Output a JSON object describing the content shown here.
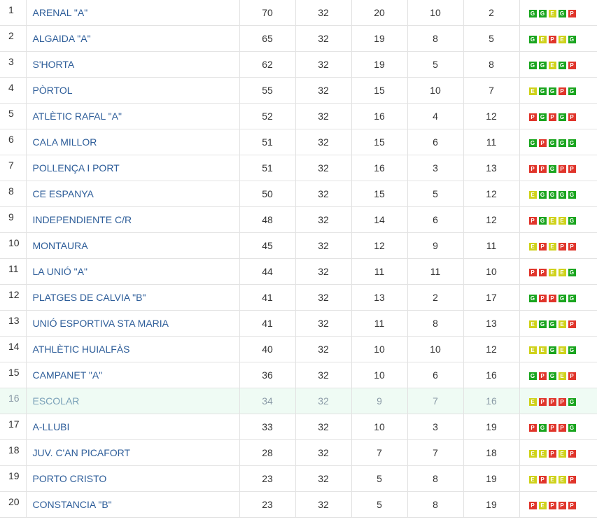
{
  "colors": {
    "win": "#1aa51f",
    "draw": "#cfd21b",
    "loss": "#e0352b",
    "highlight_row": "#effbf4",
    "team_link": "#2d5d99"
  },
  "rows": [
    {
      "pos": "1",
      "team": "ARENAL \"A\"",
      "pts": "70",
      "pj": "32",
      "pg": "20",
      "pe": "10",
      "pp": "2",
      "form": [
        "G",
        "G",
        "E",
        "G",
        "P"
      ]
    },
    {
      "pos": "2",
      "team": "ALGAIDA \"A\"",
      "pts": "65",
      "pj": "32",
      "pg": "19",
      "pe": "8",
      "pp": "5",
      "form": [
        "G",
        "E",
        "P",
        "E",
        "G"
      ]
    },
    {
      "pos": "3",
      "team": "S'HORTA",
      "pts": "62",
      "pj": "32",
      "pg": "19",
      "pe": "5",
      "pp": "8",
      "form": [
        "G",
        "G",
        "E",
        "G",
        "P"
      ]
    },
    {
      "pos": "4",
      "team": "PÒRTOL",
      "pts": "55",
      "pj": "32",
      "pg": "15",
      "pe": "10",
      "pp": "7",
      "form": [
        "E",
        "G",
        "G",
        "P",
        "G"
      ]
    },
    {
      "pos": "5",
      "team": "ATLÈTIC RAFAL \"A\"",
      "pts": "52",
      "pj": "32",
      "pg": "16",
      "pe": "4",
      "pp": "12",
      "form": [
        "P",
        "G",
        "P",
        "G",
        "P"
      ]
    },
    {
      "pos": "6",
      "team": "CALA MILLOR",
      "pts": "51",
      "pj": "32",
      "pg": "15",
      "pe": "6",
      "pp": "11",
      "form": [
        "G",
        "P",
        "G",
        "G",
        "G"
      ]
    },
    {
      "pos": "7",
      "team": "POLLENÇA I PORT",
      "pts": "51",
      "pj": "32",
      "pg": "16",
      "pe": "3",
      "pp": "13",
      "form": [
        "P",
        "P",
        "G",
        "P",
        "P"
      ]
    },
    {
      "pos": "8",
      "team": "CE ESPANYA",
      "pts": "50",
      "pj": "32",
      "pg": "15",
      "pe": "5",
      "pp": "12",
      "form": [
        "E",
        "G",
        "G",
        "G",
        "G"
      ]
    },
    {
      "pos": "9",
      "team": "INDEPENDIENTE C/R",
      "pts": "48",
      "pj": "32",
      "pg": "14",
      "pe": "6",
      "pp": "12",
      "form": [
        "P",
        "G",
        "E",
        "E",
        "G"
      ]
    },
    {
      "pos": "10",
      "team": "MONTAURA",
      "pts": "45",
      "pj": "32",
      "pg": "12",
      "pe": "9",
      "pp": "11",
      "form": [
        "E",
        "P",
        "E",
        "P",
        "P"
      ]
    },
    {
      "pos": "11",
      "team": "LA UNIÓ \"A\"",
      "pts": "44",
      "pj": "32",
      "pg": "11",
      "pe": "11",
      "pp": "10",
      "form": [
        "P",
        "P",
        "E",
        "E",
        "G"
      ]
    },
    {
      "pos": "12",
      "team": "PLATGES DE CALVIA \"B\"",
      "pts": "41",
      "pj": "32",
      "pg": "13",
      "pe": "2",
      "pp": "17",
      "form": [
        "G",
        "P",
        "P",
        "G",
        "G"
      ]
    },
    {
      "pos": "13",
      "team": "UNIÓ ESPORTIVA STA MARIA",
      "pts": "41",
      "pj": "32",
      "pg": "11",
      "pe": "8",
      "pp": "13",
      "form": [
        "E",
        "G",
        "G",
        "E",
        "P"
      ]
    },
    {
      "pos": "14",
      "team": "ATHLÈTIC HUIALFÀS",
      "pts": "40",
      "pj": "32",
      "pg": "10",
      "pe": "10",
      "pp": "12",
      "form": [
        "E",
        "E",
        "G",
        "E",
        "G"
      ]
    },
    {
      "pos": "15",
      "team": "CAMPANET \"A\"",
      "pts": "36",
      "pj": "32",
      "pg": "10",
      "pe": "6",
      "pp": "16",
      "form": [
        "G",
        "P",
        "G",
        "E",
        "P"
      ]
    },
    {
      "pos": "16",
      "team": "ESCOLAR",
      "pts": "34",
      "pj": "32",
      "pg": "9",
      "pe": "7",
      "pp": "16",
      "form": [
        "E",
        "P",
        "P",
        "P",
        "G"
      ],
      "highlight": true
    },
    {
      "pos": "17",
      "team": "A-LLUBI",
      "pts": "33",
      "pj": "32",
      "pg": "10",
      "pe": "3",
      "pp": "19",
      "form": [
        "P",
        "G",
        "P",
        "P",
        "G"
      ]
    },
    {
      "pos": "18",
      "team": "JUV. C'AN PICAFORT",
      "pts": "28",
      "pj": "32",
      "pg": "7",
      "pe": "7",
      "pp": "18",
      "form": [
        "E",
        "E",
        "P",
        "E",
        "P"
      ]
    },
    {
      "pos": "19",
      "team": "PORTO CRISTO",
      "pts": "23",
      "pj": "32",
      "pg": "5",
      "pe": "8",
      "pp": "19",
      "form": [
        "E",
        "P",
        "E",
        "E",
        "P"
      ]
    },
    {
      "pos": "20",
      "team": "CONSTANCIA \"B\"",
      "pts": "23",
      "pj": "32",
      "pg": "5",
      "pe": "8",
      "pp": "19",
      "form": [
        "P",
        "E",
        "P",
        "P",
        "P"
      ]
    }
  ]
}
